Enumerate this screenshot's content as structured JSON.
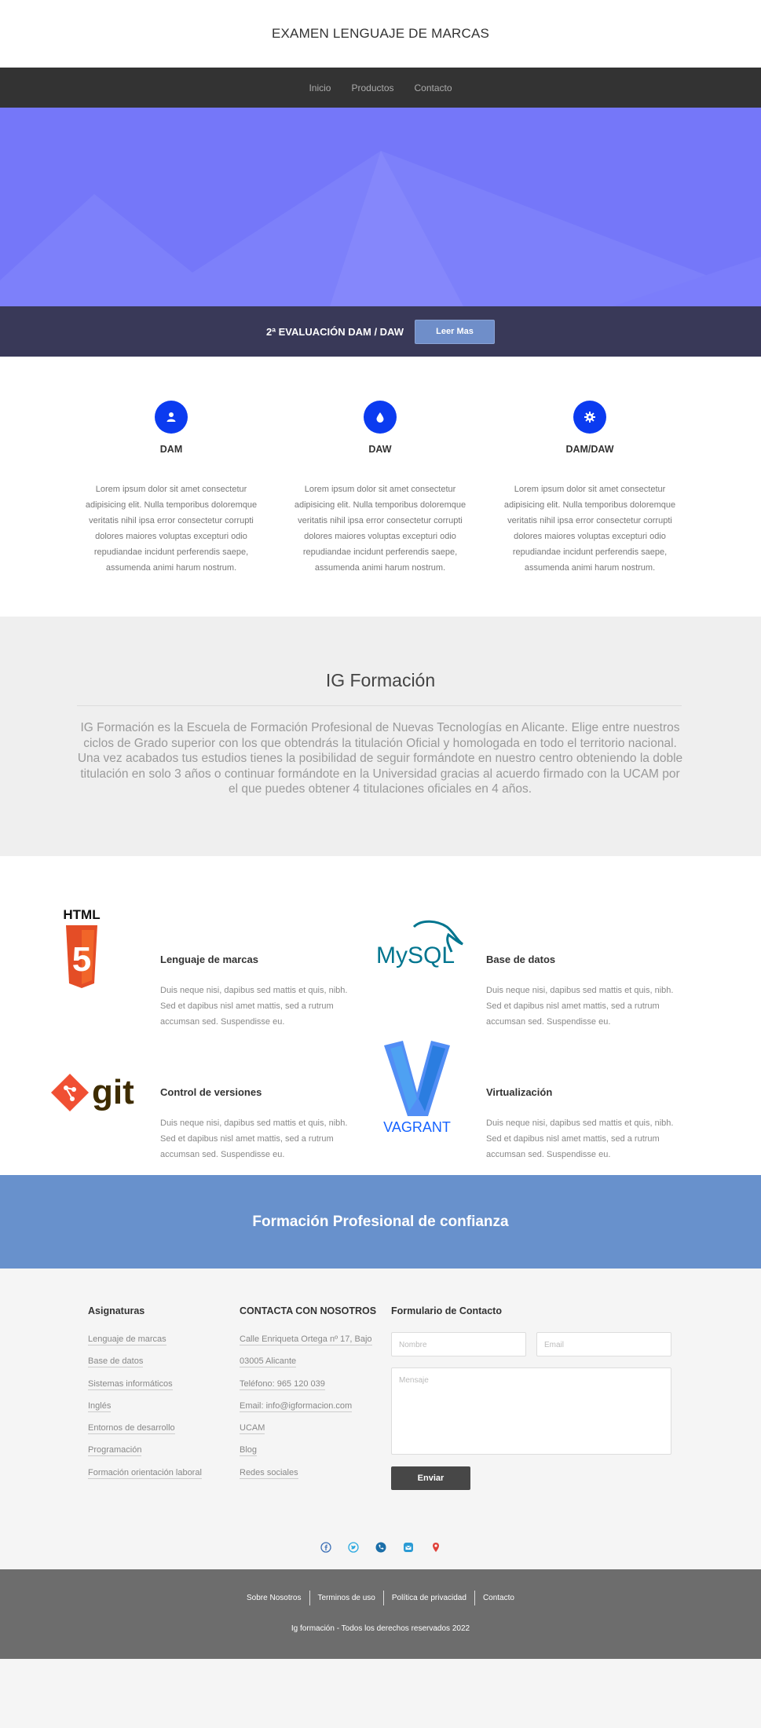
{
  "header": {
    "title": "EXAMEN LENGUAJE DE MARCAS"
  },
  "nav": {
    "items": [
      "Inicio",
      "Productos",
      "Contacto"
    ]
  },
  "hero": {
    "text": "2ª EVALUACIÓN DAM / DAW",
    "button": "Leer Mas"
  },
  "features": [
    {
      "icon": "user-icon",
      "title": "DAM",
      "text": "Lorem ipsum dolor sit amet consectetur adipisicing elit. Nulla temporibus doloremque veritatis nihil ipsa error consectetur corrupti dolores maiores voluptas excepturi odio repudiandae incidunt perferendis saepe, assumenda animi harum nostrum."
    },
    {
      "icon": "drop-icon",
      "title": "DAW",
      "text": "Lorem ipsum dolor sit amet consectetur adipisicing elit. Nulla temporibus doloremque veritatis nihil ipsa error consectetur corrupti dolores maiores voluptas excepturi odio repudiandae incidunt perferendis saepe, assumenda animi harum nostrum."
    },
    {
      "icon": "gear-icon",
      "title": "DAM/DAW",
      "text": "Lorem ipsum dolor sit amet consectetur adipisicing elit. Nulla temporibus doloremque veritatis nihil ipsa error consectetur corrupti dolores maiores voluptas excepturi odio repudiandae incidunt perferendis saepe, assumenda animi harum nostrum."
    }
  ],
  "about": {
    "title": "IG Formación",
    "text": "IG Formación es la Escuela de Formación Profesional de Nuevas Tecnologías en Alicante. Elige entre nuestros ciclos de Grado superior con los que obtendrás la titulación Oficial y homologada en todo el territorio nacional. Una vez acabados tus estudios tienes la posibilidad de seguir formándote en nuestro centro obteniendo la doble titulación en solo 3 años o continuar formándote en la Universidad gracias al acuerdo firmado con la UCAM por el que puedes obtener 4 titulaciones oficiales en 4 años."
  },
  "techs": [
    {
      "logo": "html5-logo",
      "logo_text": "HTML",
      "logo_number": "5",
      "title": "Lenguaje de marcas",
      "text": "Duis neque nisi, dapibus sed mattis et quis, nibh. Sed et dapibus nisl amet mattis, sed a rutrum accumsan sed. Suspendisse eu."
    },
    {
      "logo": "mysql-logo",
      "logo_text": "MySQL",
      "title": "Base de datos",
      "text": "Duis neque nisi, dapibus sed mattis et quis, nibh. Sed et dapibus nisl amet mattis, sed a rutrum accumsan sed. Suspendisse eu."
    },
    {
      "logo": "git-logo",
      "logo_text": "git",
      "title": "Control de versiones",
      "text": "Duis neque nisi, dapibus sed mattis et quis, nibh. Sed et dapibus nisl amet mattis, sed a rutrum accumsan sed. Suspendisse eu."
    },
    {
      "logo": "vagrant-logo",
      "logo_text": "VAGRANT",
      "title": "Virtualización",
      "text": "Duis neque nisi, dapibus sed mattis et quis, nibh. Sed et dapibus nisl amet mattis, sed a rutrum accumsan sed. Suspendisse eu."
    }
  ],
  "banner": {
    "title": "Formación Profesional de confianza"
  },
  "contact": {
    "col1": {
      "title": "Asignaturas",
      "items": [
        "Lenguaje de marcas",
        "Base de datos",
        "Sistemas informáticos",
        "Inglés",
        "Entornos de desarrollo",
        "Programación",
        "Formación orientación laboral"
      ]
    },
    "col2": {
      "title": "CONTACTA CON NOSOTROS",
      "items": [
        "Calle Enriqueta Ortega nº 17, Bajo",
        "03005 Alicante",
        "Teléfono: 965 120 039",
        "Email: info@igformacion.com",
        "UCAM",
        "Blog",
        "Redes sociales"
      ]
    },
    "form": {
      "title": "Formulario de Contacto",
      "name_placeholder": "Nombre",
      "email_placeholder": "Email",
      "message_placeholder": "Mensaje",
      "submit": "Enviar"
    }
  },
  "socials": [
    "facebook-icon",
    "twitter-icon",
    "phone-icon",
    "mail-icon",
    "location-icon"
  ],
  "footer": {
    "links": [
      "Sobre Nosotros",
      "Terminos de uso",
      "Política de privacidad",
      "Contacto"
    ],
    "copyright": "Ig formación - Todos los derechos reservados 2022"
  },
  "colors": {
    "hero": "#7577f9",
    "accent": "#0b3bf0",
    "banner": "#6891cc",
    "footer": "#6d6d6d"
  }
}
